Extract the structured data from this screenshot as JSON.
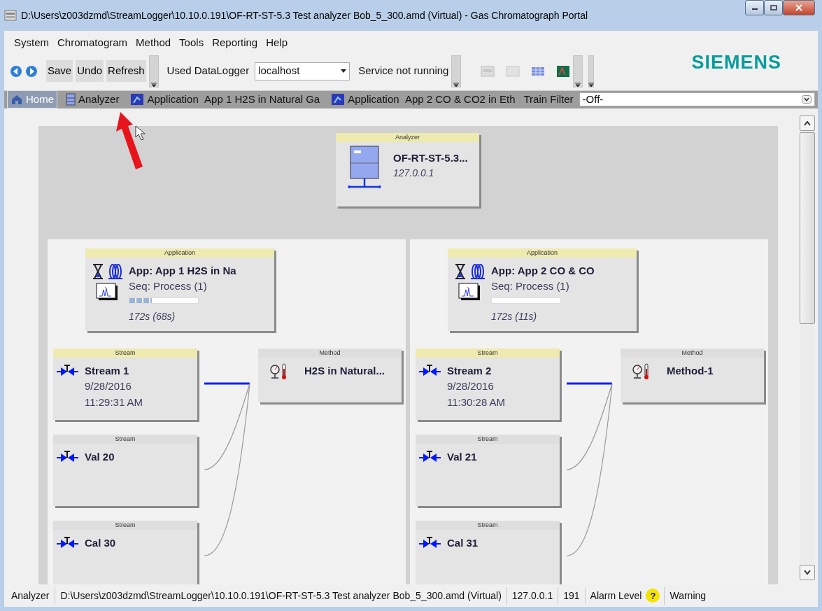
{
  "window": {
    "title": "D:\\Users\\z003dzmd\\StreamLogger\\10.10.0.191\\OF-RT-ST-5.3 Test analyzer Bob_5_300.amd (Virtual) - Gas Chromatograph Portal"
  },
  "menu": [
    "System",
    "Chromatogram",
    "Method",
    "Tools",
    "Reporting",
    "Help"
  ],
  "toolbar": {
    "buttons": [
      "Save",
      "Undo",
      "Refresh"
    ],
    "datalogger_label": "Used DataLogger",
    "datalogger": {
      "value": "localhost"
    },
    "service_status": "Service not running",
    "logo": "SIEMENS"
  },
  "nav": {
    "items": [
      {
        "kind": "home",
        "label": "Home",
        "selected": true
      },
      {
        "kind": "analyzer",
        "label": "Analyzer",
        "selected": false
      },
      {
        "kind": "application",
        "label": "Application",
        "detail": "App 1 H2S in Natural Ga",
        "selected": false
      },
      {
        "kind": "application",
        "label": "Application",
        "detail": "App 2 CO & CO2 in Eth",
        "selected": false
      }
    ],
    "filter_label": "Train Filter",
    "filter": {
      "value": "-Off-"
    }
  },
  "analyzer": {
    "header": "Analyzer",
    "name": "OF-RT-ST-5.3...",
    "address": "127.0.0.1"
  },
  "applications": [
    {
      "header": "Application",
      "name": "App: App 1 H2S in Na",
      "sequence": "Seq: Process (1)",
      "level": 0.33,
      "time": "172s (68s)",
      "streams": [
        {
          "header": "Stream",
          "name": "Stream 1",
          "date": "9/28/2016",
          "time": "11:29:31 AM",
          "active": true
        },
        {
          "header": "Stream",
          "name": "Val 20",
          "active": false
        },
        {
          "header": "Stream",
          "name": "Cal 30",
          "active": false
        }
      ],
      "method": {
        "header": "Method",
        "name": "H2S in Natural..."
      }
    },
    {
      "header": "Application",
      "name": "App: App 2 CO & CO",
      "sequence": "Seq: Process (1)",
      "level": 0,
      "time": "172s (11s)",
      "streams": [
        {
          "header": "Stream",
          "name": "Stream 2",
          "date": "9/28/2016",
          "time": "11:30:28 AM",
          "active": true
        },
        {
          "header": "Stream",
          "name": "Val 21",
          "active": false
        },
        {
          "header": "Stream",
          "name": "Cal 31",
          "active": false
        }
      ],
      "method": {
        "header": "Method",
        "name": "Method-1"
      }
    }
  ],
  "status_bar": {
    "label": "Analyzer",
    "path": "D:\\Users\\z003dzmd\\StreamLogger\\10.10.0.191\\OF-RT-ST-5.3 Test analyzer Bob_5_300.amd (Virtual)",
    "address": "127.0.0.1",
    "count": "191",
    "alarm_label": "Alarm Level",
    "alarm_icon": "?",
    "alarm": "Warning"
  }
}
